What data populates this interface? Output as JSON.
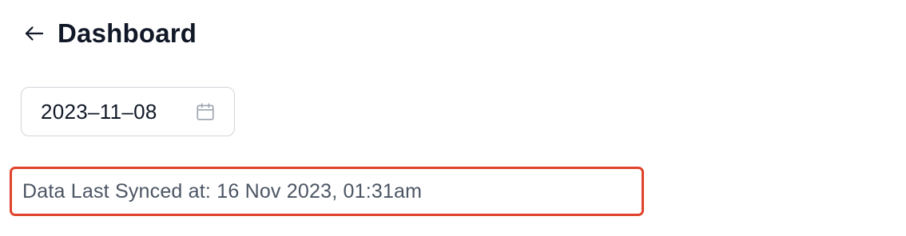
{
  "header": {
    "back_icon": "arrow-left-icon",
    "title": "Dashboard"
  },
  "date_picker": {
    "value": "2023–11–08",
    "icon": "calendar-icon"
  },
  "sync_status": {
    "text": "Data Last Synced at: 16 Nov 2023, 01:31am",
    "highlight_color": "#e0432b"
  }
}
